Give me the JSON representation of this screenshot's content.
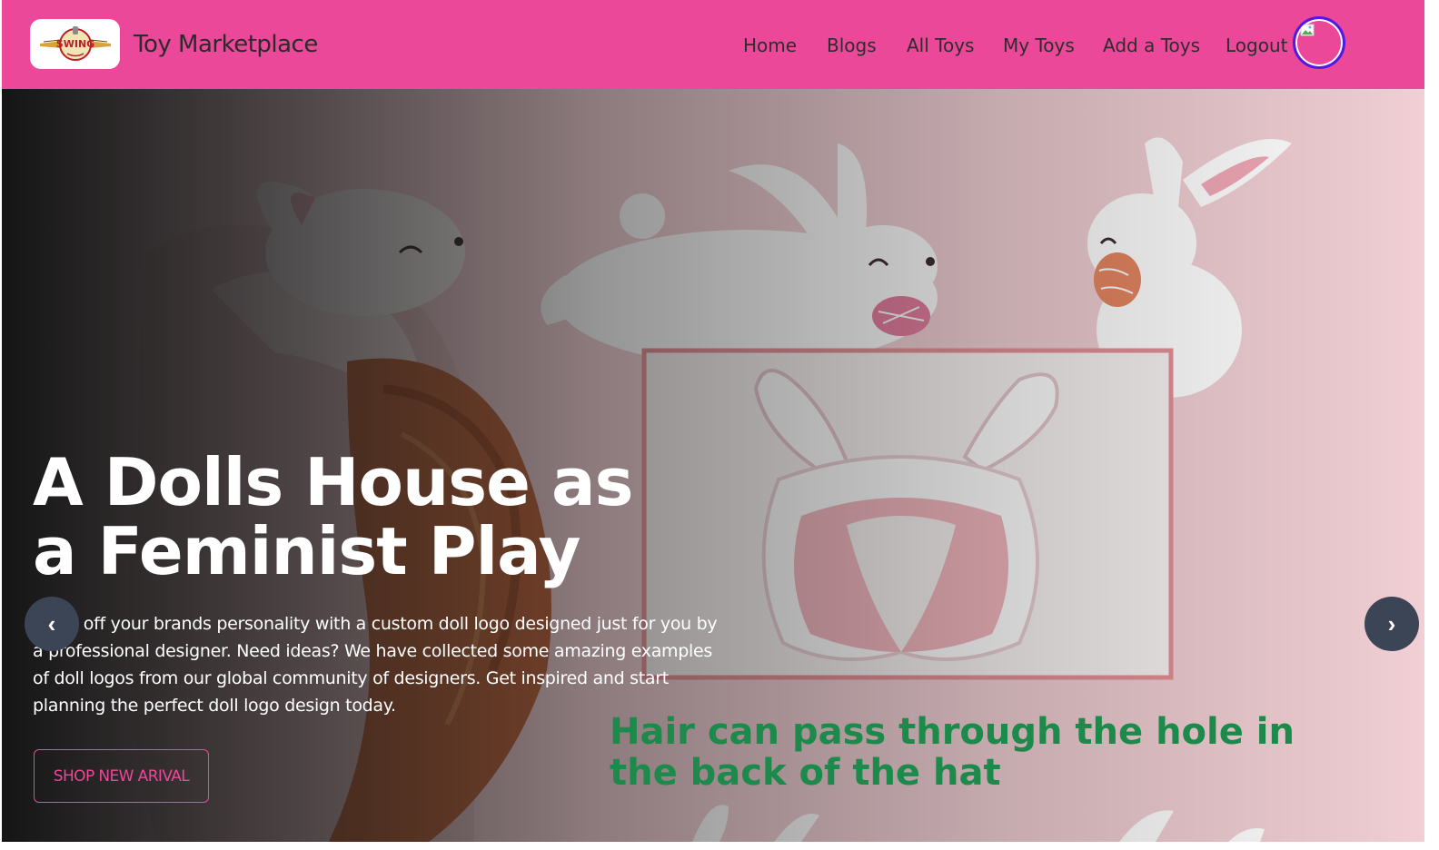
{
  "navbar": {
    "brand_title": "Toy Marketplace",
    "logo_text": "SWING",
    "links": [
      "Home",
      "Blogs",
      "All Toys",
      "My Toys",
      "Add a Toys",
      "Logout"
    ],
    "colors": {
      "background": "#ec4899",
      "avatar_ring": "#4f19e6"
    }
  },
  "hero": {
    "title": "A Dolls House as a Feminist Play",
    "text": "Show off your brands personality with a custom doll logo designed just for you by a professional designer. Need ideas? We have collected some amazing examples of doll logos from our global community of designers. Get inspired and start planning the perfect doll logo design today.",
    "cta_label": "SHOP NEW ARIVAL",
    "image_caption": "Hair can pass through the hole in the back of the hat",
    "prev_icon": "‹",
    "next_icon": "›",
    "colors": {
      "cta": "#ec4899",
      "caption": "#1c8a4a",
      "carousel_button": "#3b4556"
    }
  }
}
